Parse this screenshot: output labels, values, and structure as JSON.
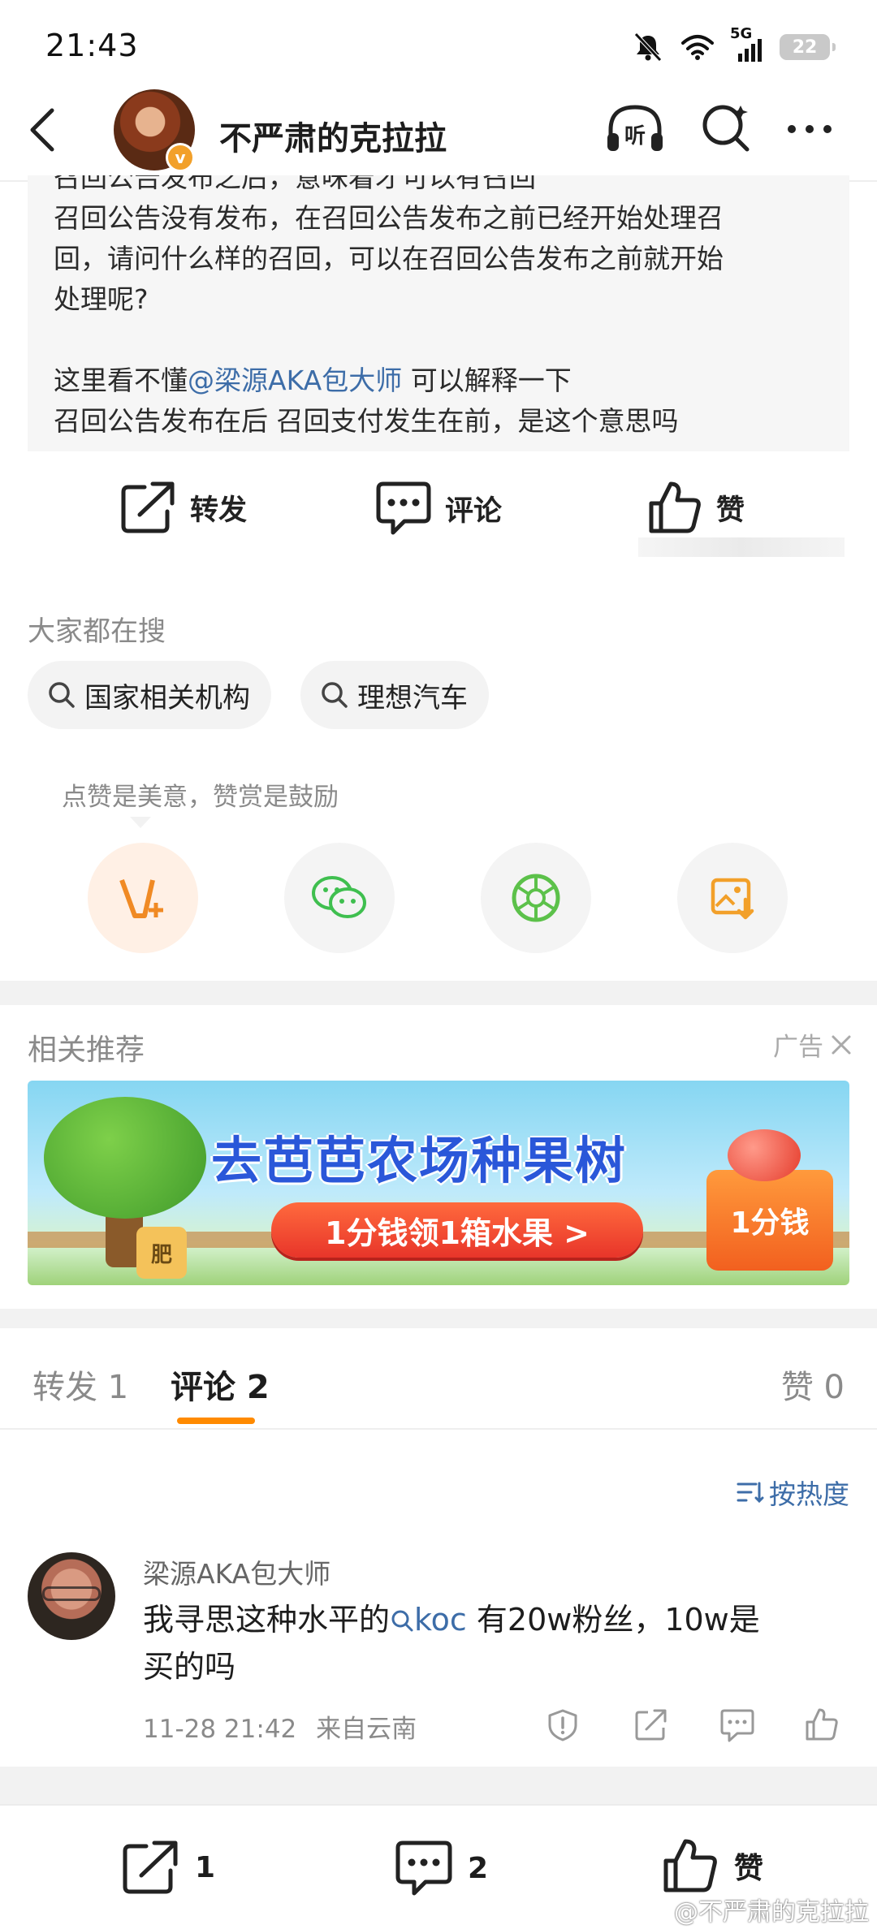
{
  "status_bar": {
    "time": "21:43",
    "network": "5G",
    "battery": "22"
  },
  "header": {
    "title": "不严肃的克拉拉",
    "verify": "v"
  },
  "quote": {
    "line0": "召回公告发布之后，意味着才可以有召回",
    "line1": "召回公告没有发布，在召回公告发布之前已经开始处理召",
    "line2": "回，请问什么样的召回，可以在召回公告发布之前就开始",
    "line3": "处理呢?",
    "line4_prefix": "这里看不懂",
    "line4_mention": "@梁源AKA包大师",
    "line4_suffix": " 可以解释一下",
    "line5": "召回公告发布在后 召回支付发生在前，是这个意思吗"
  },
  "actions": {
    "repost": "转发",
    "comment": "评论",
    "like": "赞"
  },
  "hot_search": {
    "label": "大家都在搜",
    "chips": [
      "国家相关机构",
      "理想汽车"
    ]
  },
  "reward_tip": "点赞是美意，赞赏是鼓励",
  "share_icons": [
    "v-plus-icon",
    "wechat-icon",
    "moments-icon",
    "save-image-icon"
  ],
  "recommend": {
    "label": "相关推荐",
    "ad": "广告"
  },
  "ad_banner": {
    "title": "去芭芭农场种果树",
    "button": "1分钱领1箱水果 >",
    "badge": "1分钱",
    "pot": "肥"
  },
  "tabs": {
    "repost": "转发 1",
    "comment": "评论 2",
    "like": "赞 0"
  },
  "sort": "按热度",
  "comment": {
    "user": "梁源AKA包大师",
    "text_prefix": "我寻思这种水平的",
    "text_link": "koc",
    "text_rest1": " 有20w粉丝，10w是",
    "text_rest2": "买的吗",
    "time": "11-28 21:42",
    "location": "来自云南"
  },
  "bottom_bar": {
    "repost_count": "1",
    "comment_count": "2",
    "like": "赞"
  },
  "watermark": "@不严肃的克拉拉",
  "colors": {
    "link": "#3d6da8",
    "accent": "#ff8a00",
    "background": "#ffffff",
    "band": "#f2f2f2"
  }
}
